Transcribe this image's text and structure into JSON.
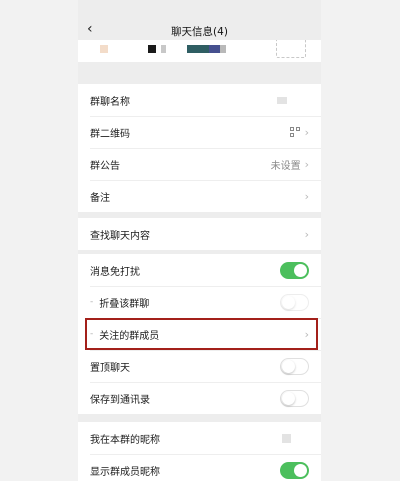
{
  "topbar": {
    "title": "聊天信息(4)",
    "back_icon": "chevron-left-icon"
  },
  "settings": {
    "group_name_label": "群聊名称",
    "qr_label": "群二维码",
    "qr_icon": "qr-code-icon",
    "notice_label": "群公告",
    "notice_value": "未设置",
    "remark_label": "备注",
    "search_label": "查找聊天内容",
    "mute_label": "消息免打扰",
    "mute_on": true,
    "fold_label": "折叠该群聊",
    "fold_on": false,
    "follow_label": "关注的群成员",
    "pin_label": "置顶聊天",
    "pin_on": false,
    "save_label": "保存到通讯录",
    "save_on": false,
    "nickname_label": "我在本群的昵称",
    "show_nick_label": "显示群成员昵称",
    "show_nick_on": true
  },
  "colors": {
    "toggle_on": "#4cbf5d",
    "highlight_border": "#a3201a"
  }
}
